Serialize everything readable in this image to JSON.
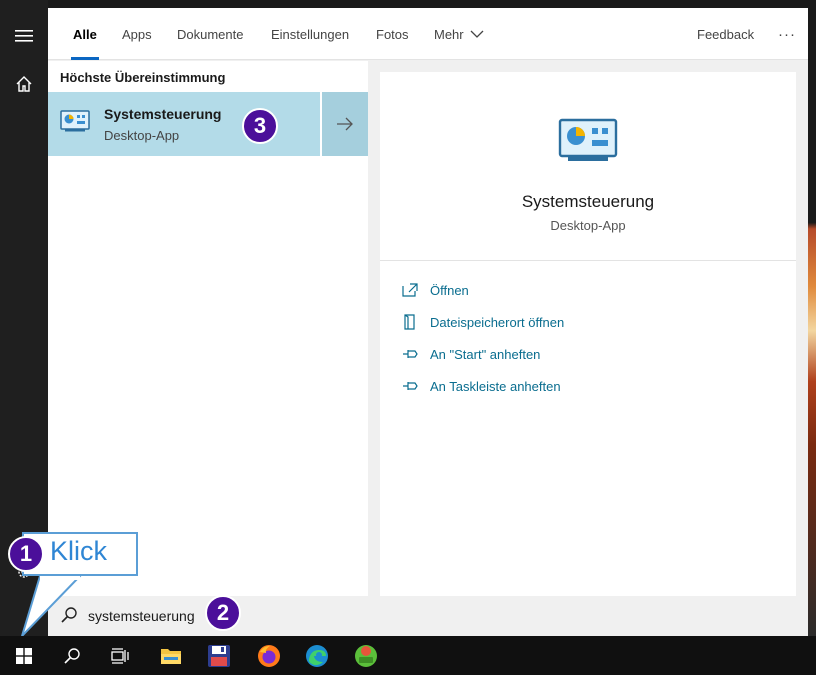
{
  "tabs": [
    {
      "label": "Alle",
      "active": true
    },
    {
      "label": "Apps"
    },
    {
      "label": "Dokumente"
    },
    {
      "label": "Einstellungen"
    },
    {
      "label": "Fotos"
    },
    {
      "label": "Mehr"
    }
  ],
  "header": {
    "feedback_label": "Feedback",
    "more_label": "···"
  },
  "results": {
    "section_title": "Höchste Übereinstimmung",
    "best_match": {
      "title": "Systemsteuerung",
      "subtitle": "Desktop-App"
    }
  },
  "detail": {
    "title": "Systemsteuerung",
    "subtitle": "Desktop-App",
    "actions": [
      {
        "label": "Öffnen",
        "icon": "open-icon"
      },
      {
        "label": "Dateispeicherort öffnen",
        "icon": "file-location-icon"
      },
      {
        "label": "An \"Start\" anheften",
        "icon": "pin-icon"
      },
      {
        "label": "An Taskleiste anheften",
        "icon": "pin-icon"
      }
    ]
  },
  "search": {
    "value": "systemsteuerung"
  },
  "callouts": {
    "m1": "1",
    "m2": "2",
    "m3": "3",
    "klick": "Klick"
  },
  "taskbar": {
    "icons": [
      "windows-start-icon",
      "search-icon",
      "task-view-icon",
      "file-explorer-icon",
      "save-app-icon",
      "firefox-icon",
      "edge-icon",
      "pos-app-icon"
    ]
  },
  "colors": {
    "accent": "#0a66c2",
    "selection": "#b3dbe8",
    "link": "#0a6d8f",
    "callout": "#4b0f9a"
  }
}
